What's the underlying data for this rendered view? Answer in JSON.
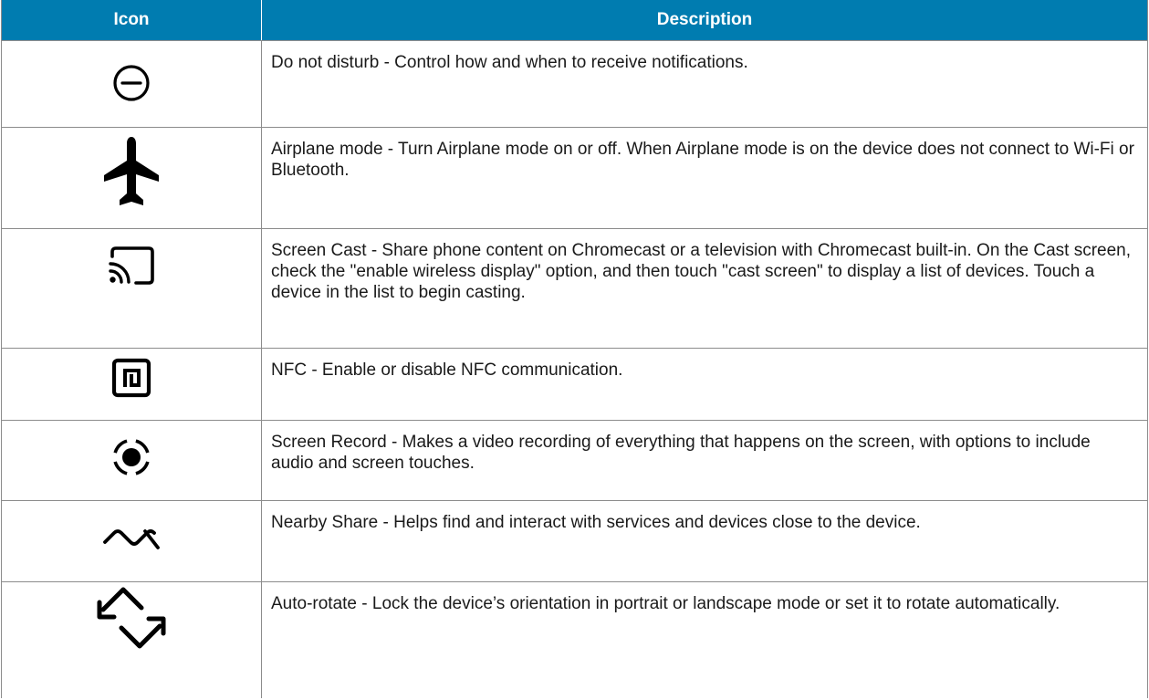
{
  "table": {
    "headers": {
      "icon": "Icon",
      "description": "Description"
    },
    "header_color": "#007cb0",
    "rows": [
      {
        "icon": "do-not-disturb-icon",
        "description": "Do not disturb - Control how and when to receive notifications."
      },
      {
        "icon": "airplane-icon",
        "description": "Airplane mode - Turn Airplane mode on or off. When Airplane mode is on the device does not connect to Wi-Fi or Bluetooth."
      },
      {
        "icon": "screen-cast-icon",
        "description": "Screen Cast - Share phone content on Chromecast or a television with Chromecast built-in. On the Cast screen, check the \"enable wireless display\" option, and then touch \"cast screen\" to display a list of devices. Touch a device in the list to begin casting."
      },
      {
        "icon": "nfc-icon",
        "description": "NFC - Enable or disable NFC communication."
      },
      {
        "icon": "screen-record-icon",
        "description": "Screen Record - Makes a video recording of everything that happens on the screen, with options to include audio and screen touches."
      },
      {
        "icon": "nearby-share-icon",
        "description": "Nearby Share - Helps find and interact with services and devices close to the device."
      },
      {
        "icon": "auto-rotate-icon",
        "description": "Auto-rotate - Lock the device’s orientation in portrait or landscape mode or set it to rotate automatically."
      }
    ]
  }
}
